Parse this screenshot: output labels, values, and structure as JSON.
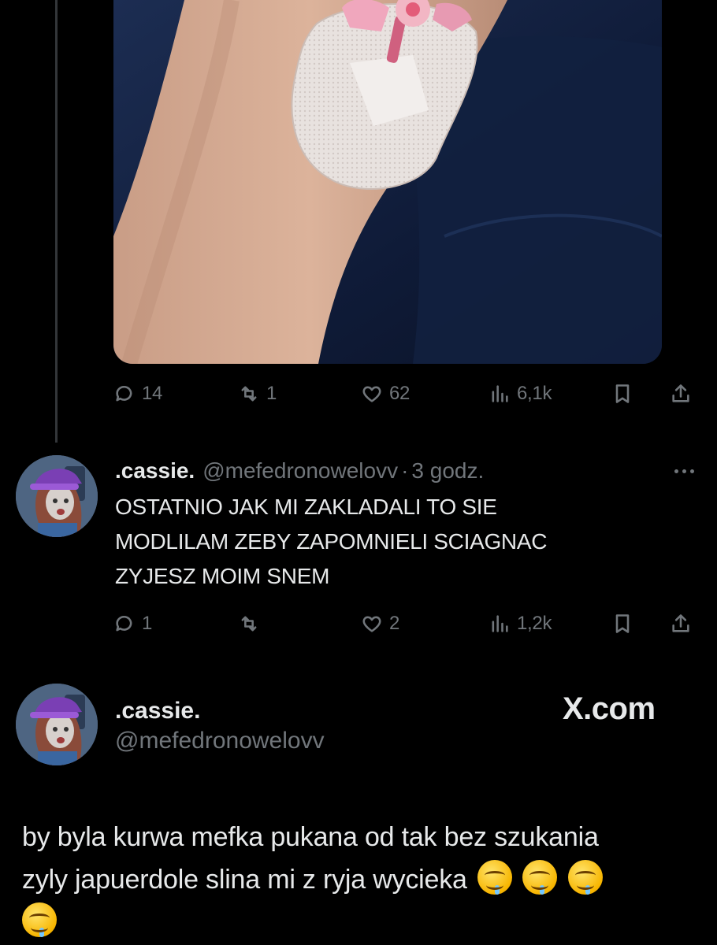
{
  "top_post": {
    "stats": {
      "replies": "14",
      "reposts": "1",
      "likes": "62",
      "views": "6,1k"
    }
  },
  "reply": {
    "display_name": ".cassie.",
    "handle": "@mefedronowelovv",
    "separator": "·",
    "time": "3 godz.",
    "text_lines": [
      "OSTATNIO JAK MI ZAKLADALI TO SIE",
      "MODLILAM ZEBY ZAPOMNIELI SCIAGNAC",
      "ZYJESZ MOIM SNEM"
    ],
    "stats": {
      "replies": "1",
      "reposts": "",
      "likes": "2",
      "views": "1,2k"
    }
  },
  "quoted": {
    "display_name": ".cassie.",
    "handle": "@mefedronowelovv",
    "brand": "X.com",
    "text_line_1": "by byla kurwa mefka pukana od tak bez szukania",
    "text_line_2": "zyly japuerdole slina mi z ryja wycieka"
  },
  "icons": {
    "reply": "speech-bubble-icon",
    "repost": "repost-arrows-icon",
    "like": "heart-icon",
    "views": "bar-chart-icon",
    "bookmark": "bookmark-icon",
    "share": "share-upload-icon",
    "more": "ellipsis-icon",
    "emoji": "drooling-face-emoji"
  },
  "colors": {
    "background": "#000000",
    "text": "#e7e9ea",
    "muted": "#71767b",
    "thread_line": "#333639"
  }
}
